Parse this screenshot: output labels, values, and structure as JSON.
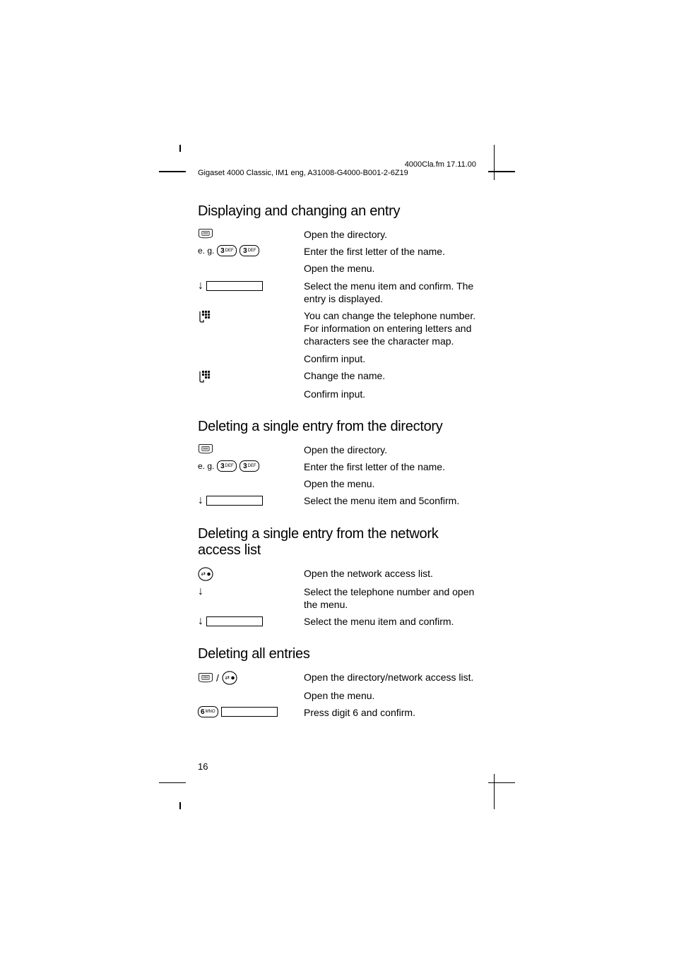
{
  "meta": {
    "file_info_right": "4000Cla.fm    17.11.00",
    "file_info_left": "Gigaset 4000 Classic, IM1 eng, A31008-G4000-B001-2-6Z19",
    "page_number": "16"
  },
  "keys": {
    "eg_prefix": "e. g.",
    "key3": "3",
    "key3sup": "DEF",
    "key6": "6",
    "key6sup": "MNO"
  },
  "sections": [
    {
      "title": "Displaying and changing an entry",
      "rows": [
        {
          "icon": "directory",
          "text": "Open the directory."
        },
        {
          "icon": "eg33",
          "text": "Enter the first letter of the name."
        },
        {
          "icon": "none",
          "text": "Open the menu."
        },
        {
          "icon": "arrow-menu",
          "text": "Select the menu item and confirm. The entry is displayed."
        },
        {
          "icon": "keypad",
          "text": "You can change the telephone number. For information on entering letters and characters see the character map."
        },
        {
          "icon": "none",
          "text": "Confirm input."
        },
        {
          "icon": "keypad",
          "text": "Change the name."
        },
        {
          "icon": "none",
          "text": "Confirm input."
        }
      ]
    },
    {
      "title": "Deleting a single entry from the directory",
      "rows": [
        {
          "icon": "directory",
          "text": "Open the directory."
        },
        {
          "icon": "eg33",
          "text": "Enter the first letter of the name."
        },
        {
          "icon": "none",
          "text": "Open the menu."
        },
        {
          "icon": "arrow-menu",
          "text": "Select the menu item and 5confirm."
        }
      ]
    },
    {
      "title": "Deleting a single entry from the network access list",
      "rows": [
        {
          "icon": "network",
          "text": "Open the network access list."
        },
        {
          "icon": "arrow",
          "text": "Select the telephone number and open the menu."
        },
        {
          "icon": "arrow-menu",
          "text": "Select the menu item and confirm."
        }
      ]
    },
    {
      "title": "Deleting all entries",
      "rows": [
        {
          "icon": "dir-network",
          "text": "Open the directory/network access list."
        },
        {
          "icon": "none",
          "text": "Open the menu."
        },
        {
          "icon": "key6-menu",
          "text": "Press digit 6 and confirm."
        }
      ]
    }
  ]
}
